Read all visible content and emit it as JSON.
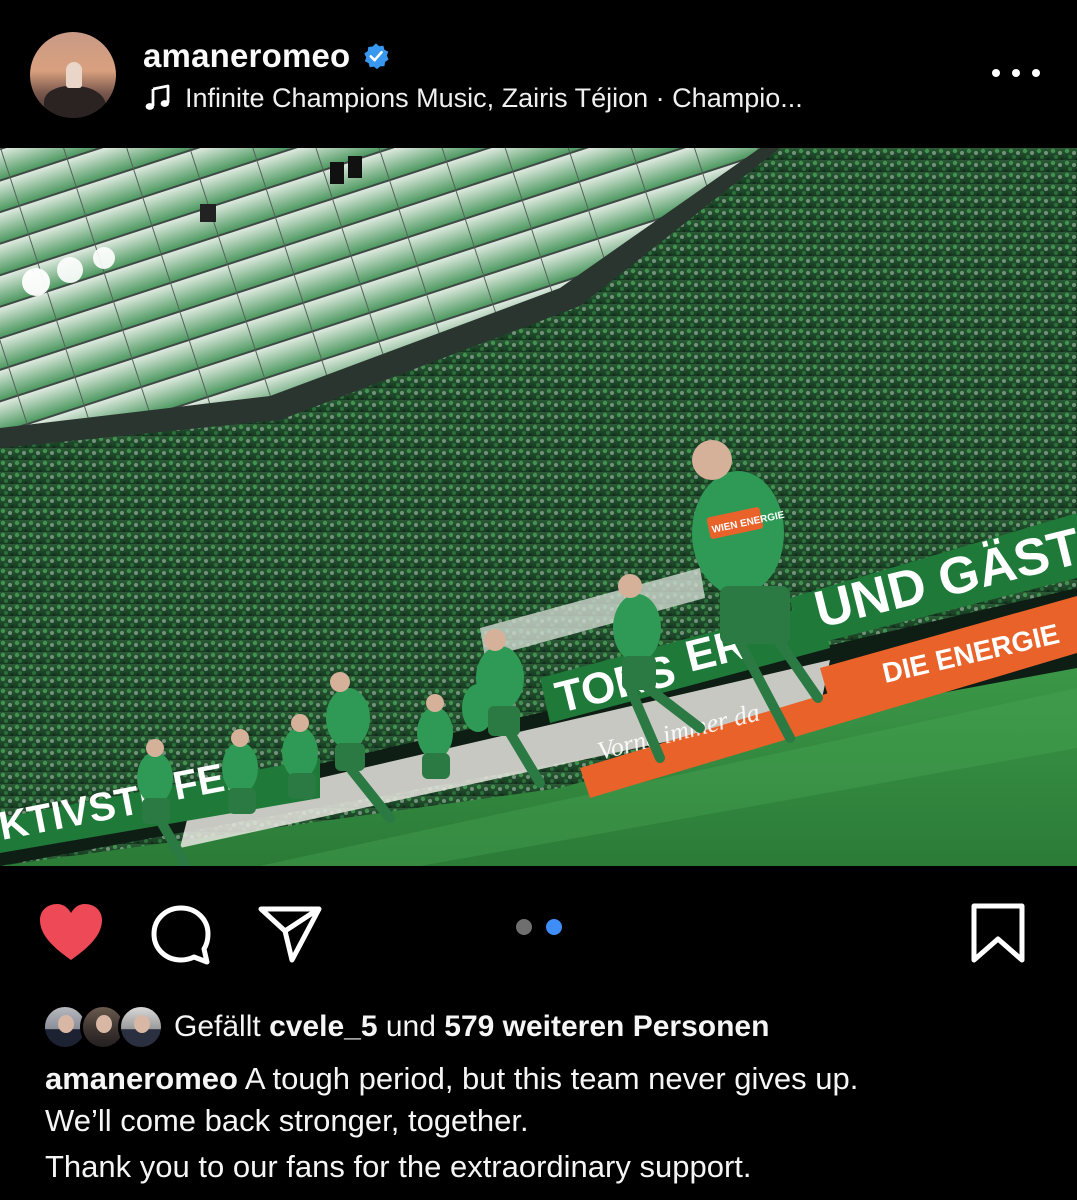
{
  "header": {
    "username": "amaneromeo",
    "verified": true,
    "music": "Infinite Champions Music, Zairis Téjion · Champio...",
    "icons": {
      "music": "music-note-icon",
      "verified": "verified-badge-icon",
      "more": "more-options-icon"
    }
  },
  "media": {
    "description_icons": {
      "mute": "speaker-muted-icon"
    },
    "carousel": {
      "count": 2,
      "active_index": 1
    },
    "banner_texts": [
      "UND GÄST",
      "DIE ENERGIE",
      "TORS",
      "ER",
      "KTIVSTR",
      "FEN",
      "WIEN ENERGIE"
    ]
  },
  "actions": {
    "like_icon": "heart-filled-icon",
    "comment_icon": "comment-icon",
    "share_icon": "paper-plane-icon",
    "save_icon": "bookmark-icon",
    "liked": true
  },
  "likes": {
    "prefix": "Gefällt",
    "user": "cvele_5",
    "connector": "und",
    "others": "579 weiteren Personen"
  },
  "caption": {
    "username": "amaneromeo",
    "line1": "A tough period, but this team never gives up.",
    "line2": "We’ll come back stronger, together.",
    "line3": "Thank you to our fans for the extraordinary support."
  },
  "colors": {
    "background": "#000000",
    "like_red": "#ed4956",
    "verified_blue": "#3897f0",
    "carousel_active": "#3f8ef7",
    "pitch_green": "#2f8a3f",
    "banner_green": "#1f7a3a",
    "sponsor_orange": "#e8622a"
  }
}
